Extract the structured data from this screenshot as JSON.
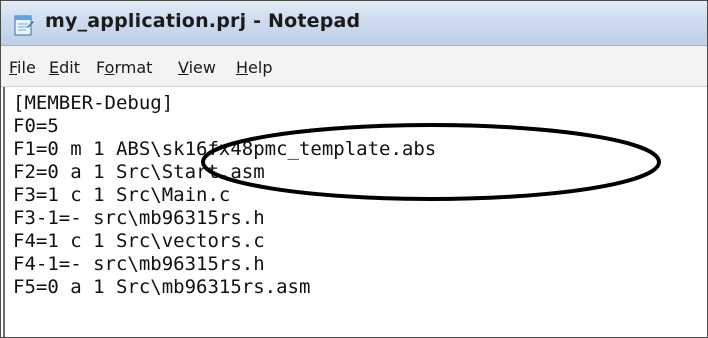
{
  "window": {
    "title": "my_application.prj - Notepad"
  },
  "icons": {
    "app": "notepad-icon"
  },
  "menu": {
    "file": {
      "accel": "F",
      "rest": "ile"
    },
    "edit": {
      "accel": "E",
      "rest": "dit"
    },
    "format": {
      "pre": "F",
      "accel": "o",
      "rest": "rmat"
    },
    "view": {
      "accel": "V",
      "rest": "iew"
    },
    "help": {
      "accel": "H",
      "rest": "elp"
    }
  },
  "document": {
    "lines": [
      "[MEMBER-Debug]",
      "F0=5",
      "F1=0 m 1 ABS\\sk16fx48pmc_template.abs",
      "F2=0 a 1 Src\\Start.asm",
      "F3=1 c 1 Src\\Main.c",
      "F3-1=- src\\mb96315rs.h",
      "F4=1 c 1 Src\\vectors.c",
      "F4-1=- src\\mb96315rs.h",
      "F5=0 a 1 Src\\mb96315rs.asm"
    ]
  },
  "colors": {
    "annotation": "#000000"
  }
}
